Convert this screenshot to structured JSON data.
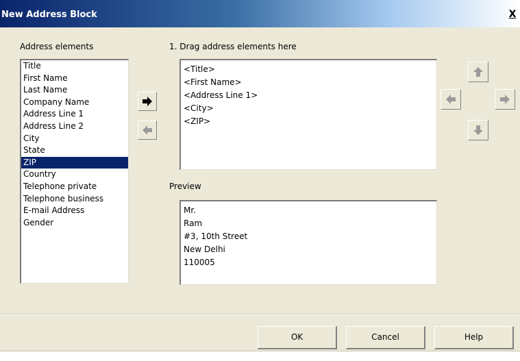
{
  "window": {
    "title": "New Address Block",
    "close_label": "X"
  },
  "address_elements": {
    "label": "Address elements",
    "items": [
      "Title",
      "First Name",
      "Last Name",
      "Company Name",
      "Address Line 1",
      "Address Line 2",
      "City",
      "State",
      "ZIP",
      "Country",
      "Telephone private",
      "Telephone business",
      "E-mail Address",
      "Gender"
    ],
    "selected": "ZIP"
  },
  "drag_area": {
    "label": "1. Drag address elements here",
    "lines": [
      "<Title>",
      "<First Name>",
      "<Address Line 1>",
      "<City>",
      "<ZIP>"
    ]
  },
  "preview": {
    "label": "Preview",
    "lines": [
      "Mr.",
      "Ram",
      "#3, 10th Street",
      "New Delhi",
      "110005"
    ]
  },
  "buttons": {
    "ok": "OK",
    "cancel": "Cancel",
    "help": "Help"
  },
  "icons": {
    "add": "arrow-right-icon",
    "remove": "arrow-left-icon",
    "move_up": "arrow-up-icon",
    "move_left": "arrow-left-icon",
    "move_right": "arrow-right-icon",
    "move_down": "arrow-down-icon"
  },
  "colors": {
    "selection": "#0a246a",
    "dialog_bg": "#ece9d8"
  }
}
